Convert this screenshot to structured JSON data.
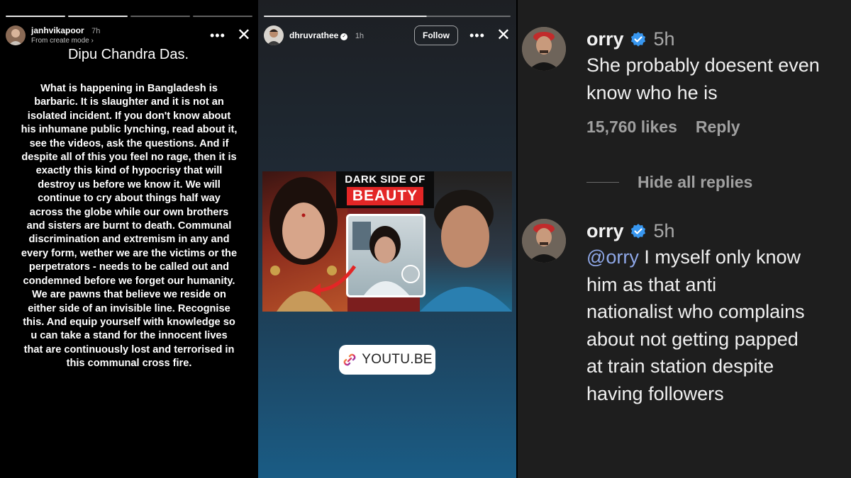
{
  "story1": {
    "username": "janhvikapoor",
    "time": "7h",
    "subtitle": "From create mode ›",
    "more_glyph": "•••",
    "close_glyph": "✕",
    "title": "Dipu Chandra Das.",
    "body": "What is happening in Bangladesh is barbaric. It is slaughter and it is not an isolated incident. If you don't know about his inhumane public lynching, read about it, see the videos, ask the questions. And if despite all of this you feel no rage, then it is exactly this kind of hypocrisy that will destroy us before we know it. We will continue to cry about things half way across the globe while our own brothers and sisters are burnt to death. Communal discrimination and extremism in any and every form, wether we are the victims or the perpetrators - needs to be called out and condemned before we forget our humanity. We are pawns that believe we reside on either side of  an invisible line. Recognise this. And equip yourself with knowledge so u can take a stand for the innocent lives that are continuously lost and terrorised in this communal cross fire."
  },
  "story2": {
    "username": "dhruvrathee",
    "time": "1h",
    "verified_glyph": "✓",
    "follow_label": "Follow",
    "more_glyph": "•••",
    "close_glyph": "✕",
    "thumbnail": {
      "line1": "DARK SIDE OF",
      "line2": "BEAUTY"
    },
    "link_sticker": "YOUTU.BE"
  },
  "comments": [
    {
      "username": "orry",
      "time": "5h",
      "lines": [
        "She probably doesent even",
        "know who he is"
      ],
      "likes": "15,760 likes",
      "reply_label": "Reply"
    },
    {
      "username": "orry",
      "time": "5h",
      "mention": "@orry",
      "lines": [
        " I myself only know",
        "him as that anti",
        "nationalist who complains",
        "about not getting papped",
        "at train station despite",
        "having followers"
      ]
    }
  ],
  "hide_replies_label": "Hide all replies",
  "colors": {
    "verified_blue": "#3897f0",
    "mention_blue": "#8fa8e8",
    "thumbnail_red": "#e32626",
    "comments_bg": "#1e1e1e"
  },
  "icons": [
    "more-icon",
    "close-icon",
    "verified-icon",
    "link-icon"
  ]
}
